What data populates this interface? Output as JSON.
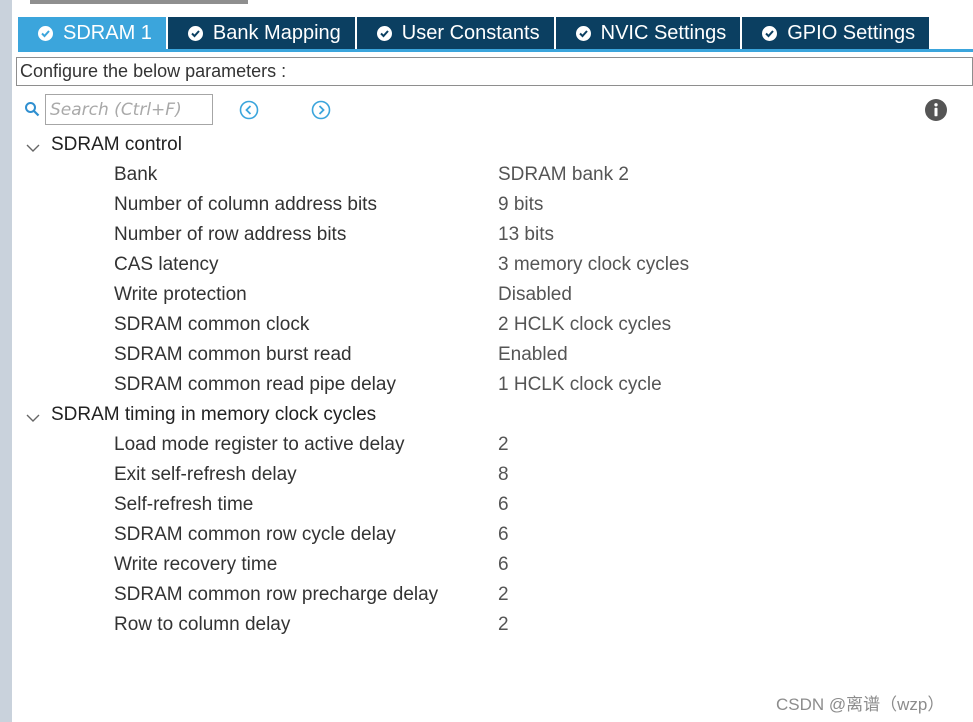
{
  "tabs": [
    {
      "label": "SDRAM 1",
      "active": true
    },
    {
      "label": "Bank Mapping",
      "active": false
    },
    {
      "label": "User Constants",
      "active": false
    },
    {
      "label": "NVIC Settings",
      "active": false
    },
    {
      "label": "GPIO Settings",
      "active": false
    }
  ],
  "configure_label": "Configure the below parameters :",
  "search": {
    "placeholder": "Search (Ctrl+F)"
  },
  "groups": [
    {
      "label": "SDRAM control",
      "expanded": true,
      "params": [
        {
          "name": "Bank",
          "value": "SDRAM bank 2"
        },
        {
          "name": "Number of column address bits",
          "value": "9 bits"
        },
        {
          "name": "Number of row address bits",
          "value": "13 bits"
        },
        {
          "name": "CAS latency",
          "value": "3 memory clock cycles"
        },
        {
          "name": "Write protection",
          "value": "Disabled"
        },
        {
          "name": "SDRAM common clock",
          "value": "2 HCLK clock cycles"
        },
        {
          "name": "SDRAM common burst read",
          "value": "Enabled"
        },
        {
          "name": "SDRAM common read pipe delay",
          "value": "1 HCLK clock cycle"
        }
      ]
    },
    {
      "label": "SDRAM timing in memory clock cycles",
      "expanded": true,
      "params": [
        {
          "name": "Load mode register to active delay",
          "value": "2"
        },
        {
          "name": "Exit self-refresh delay",
          "value": "8"
        },
        {
          "name": "Self-refresh time",
          "value": "6"
        },
        {
          "name": "SDRAM common row cycle delay",
          "value": "6"
        },
        {
          "name": "Write recovery time",
          "value": "6"
        },
        {
          "name": "SDRAM common row precharge delay",
          "value": "2"
        },
        {
          "name": "Row to column delay",
          "value": "2"
        }
      ]
    }
  ],
  "watermark": "CSDN @离谱（wzp）",
  "colors": {
    "tab_active": "#3ba5dc",
    "tab_inactive": "#0b3f61",
    "nav_icon": "#3ba5dc",
    "info_icon": "#555555"
  }
}
